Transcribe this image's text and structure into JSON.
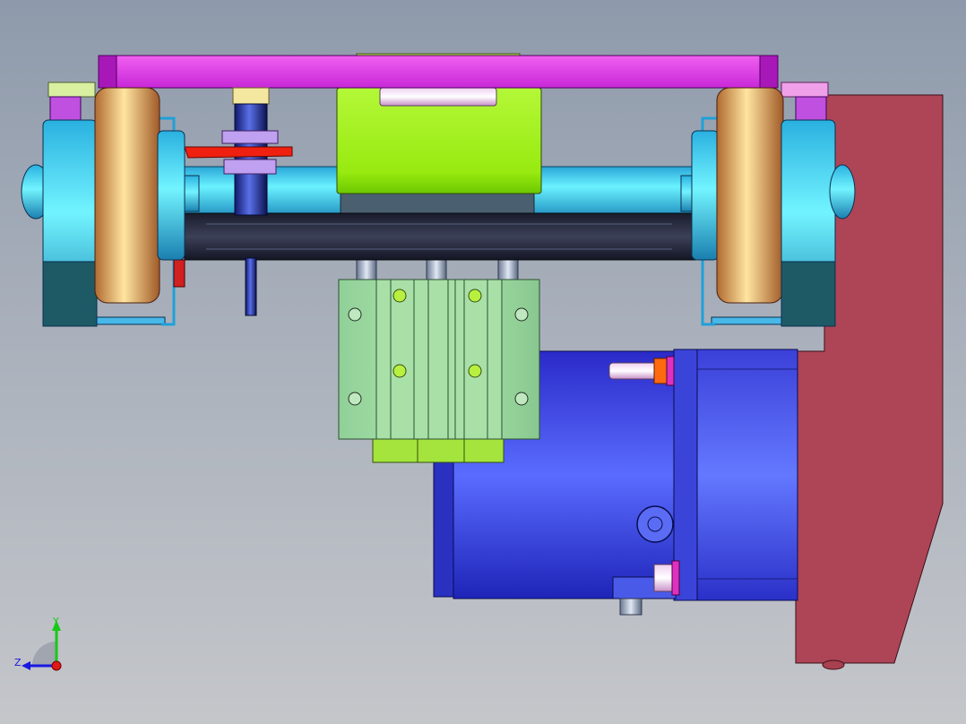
{
  "triad": {
    "x_label": "",
    "y_label": "Y",
    "z_label": "Z"
  },
  "colors": {
    "background_top": "#8e9aab",
    "background_bottom": "#c4c6ca",
    "top_plate": "#e23ee6",
    "wheel_tire": "#f0b070",
    "wheel_hub": "#3ed0f0",
    "shaft": "#48e0f8",
    "block": "#a4f01e",
    "motor": "#4a58e8",
    "bracket": "#aa4455",
    "slide_block": "#98d8a0",
    "dark_beam": "#2a2e44",
    "axis_x": "#e01818",
    "axis_y": "#18c818",
    "axis_z": "#1818e0"
  }
}
